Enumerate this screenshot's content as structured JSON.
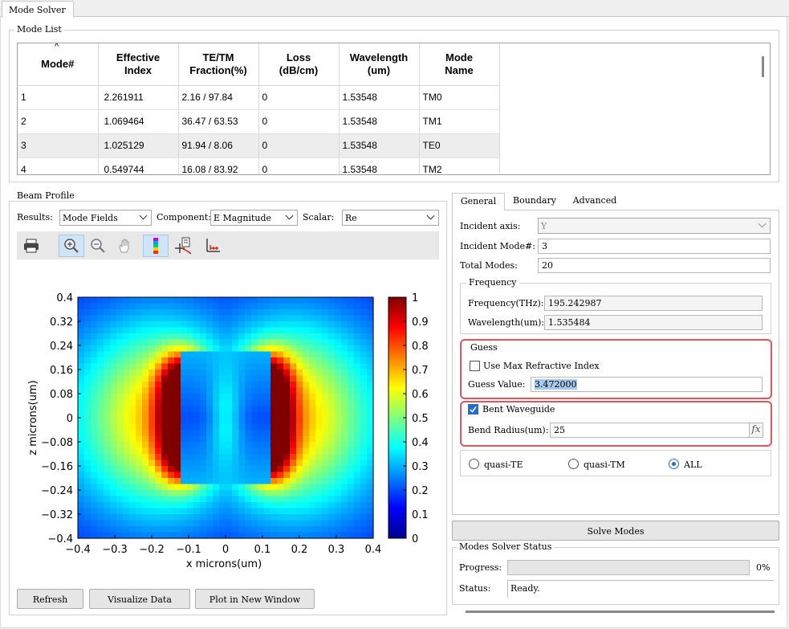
{
  "window": {
    "tab_label": "Mode Solver"
  },
  "mode_list": {
    "title": "Mode List",
    "sort_indicator": "^",
    "columns": [
      {
        "line1": "Mode#",
        "line2": ""
      },
      {
        "line1": "Effective",
        "line2": "Index"
      },
      {
        "line1": "TE/TM",
        "line2": "Fraction(%)"
      },
      {
        "line1": "Loss",
        "line2": "(dB/cm)"
      },
      {
        "line1": "Wavelength",
        "line2": "(um)"
      },
      {
        "line1": "Mode",
        "line2": "Name"
      }
    ],
    "rows": [
      [
        "1",
        "2.261911",
        "2.16 / 97.84",
        "0",
        "1.53548",
        "TM0"
      ],
      [
        "2",
        "1.069464",
        "36.47 / 63.53",
        "0",
        "1.53548",
        "TM1"
      ],
      [
        "3",
        "1.025129",
        "91.94 / 8.06",
        "0",
        "1.53548",
        "TE0"
      ],
      [
        "4",
        "0.549744",
        "16.08 / 83.92",
        "0",
        "1.53548",
        "TM2"
      ]
    ],
    "selected_row": 2
  },
  "beam_profile": {
    "title": "Beam Profile",
    "results_label": "Results:",
    "results_value": "Mode Fields",
    "component_label": "Component:",
    "component_value": "E Magnitude",
    "scalar_label": "Scalar:",
    "scalar_value": "Re",
    "buttons": {
      "refresh": "Refresh",
      "visualize": "Visualize Data",
      "plot_new": "Plot in New Window"
    }
  },
  "chart_data": {
    "type": "heatmap",
    "title": "",
    "xlabel": "x microns(um)",
    "ylabel": "z microns(um)",
    "xlim": [
      -0.4,
      0.4
    ],
    "ylim": [
      -0.4,
      0.4
    ],
    "x_ticks": [
      "-0.4",
      "-0.3",
      "-0.2",
      "-0.1",
      "0",
      "0.1",
      "0.2",
      "0.3",
      "0.4"
    ],
    "y_ticks": [
      "0.4",
      "0.32",
      "0.24",
      "0.16",
      "0.08",
      "0",
      "-0.08",
      "-0.16",
      "-0.24",
      "-0.32",
      "-0.4"
    ],
    "colorbar_ticks": [
      "1",
      "0.9",
      "0.8",
      "0.7",
      "0.6",
      "0.5",
      "0.4",
      "0.3",
      "0.2",
      "0.1",
      "0"
    ],
    "colorbar_range": [
      0,
      1
    ],
    "colormap": "jet",
    "grid": false,
    "description_of_field": {
      "lobe_x_center": 0.12,
      "lobe_z_extent": [
        -0.2,
        0.2
      ],
      "peak_value": 1.0
    }
  },
  "settings": {
    "tabs": [
      "General",
      "Boundary",
      "Advanced"
    ],
    "active_tab": "General",
    "incident_axis_label": "Incident axis:",
    "incident_axis_value": "Y",
    "incident_mode_label": "Incident Mode#:",
    "incident_mode_value": "3",
    "total_modes_label": "Total Modes:",
    "total_modes_value": "20",
    "frequency_group": "Frequency",
    "frequency_label": "Frequency(THz):",
    "frequency_value": "195.242987",
    "wavelength_label": "Wavelength(um):",
    "wavelength_value": "1.535484",
    "guess_group": "Guess",
    "use_max_label": "Use Max Refractive Index",
    "use_max_checked": false,
    "guess_value_label": "Guess Value:",
    "guess_value": "3.472000",
    "bent_label": "Bent Waveguide",
    "bent_checked": true,
    "bend_radius_label": "Bend Radius(um):",
    "bend_radius_value": "25",
    "fx_label": "fx",
    "polarization": [
      "quasi-TE",
      "quasi-TM",
      "ALL"
    ],
    "polarization_selected": "ALL",
    "solve_button": "Solve Modes",
    "status_group": "Modes Solver Status",
    "progress_label": "Progress:",
    "progress_value": 0,
    "progress_text": "0%",
    "status_label": "Status:",
    "status_value": "Ready."
  },
  "colors": {
    "accent": "#1f6fd1",
    "highlight_box": "#e0565b",
    "selected_row": "#ededed"
  }
}
